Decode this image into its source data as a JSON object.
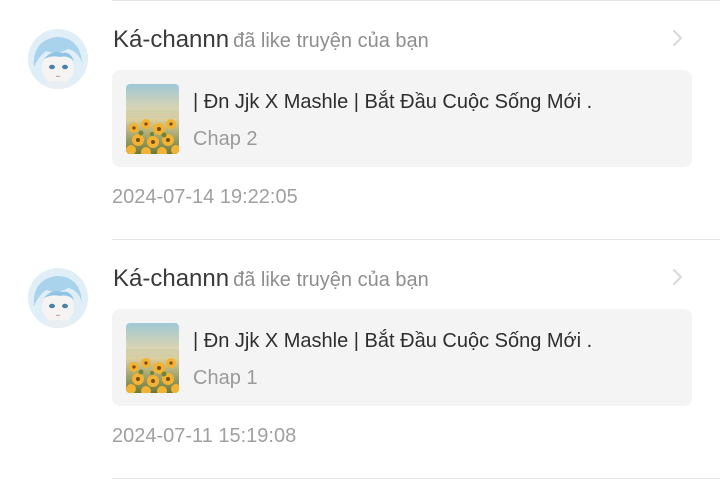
{
  "notifications": [
    {
      "user": "Ká-channn",
      "action": "đã like truyện của bạn",
      "story_title": "| Đn Jjk X Mashle | Bắt Đầu Cuộc Sống Mới .",
      "chapter": "Chap 2",
      "timestamp": "2024-07-14 19:22:05"
    },
    {
      "user": "Ká-channn",
      "action": "đã like truyện của bạn",
      "story_title": "| Đn Jjk X Mashle | Bắt Đầu Cuộc Sống Mới .",
      "chapter": "Chap 1",
      "timestamp": "2024-07-11 15:19:08"
    }
  ],
  "icons": {
    "avatar": "user-avatar",
    "cover": "story-cover-image",
    "chevron": "chevron-right-icon"
  },
  "colors": {
    "card_background": "#f4f4f4",
    "username": "#3a3a3a",
    "secondary_text": "#8e8e8e",
    "timestamp": "#a0a0a0",
    "divider": "#e6e6e6"
  }
}
